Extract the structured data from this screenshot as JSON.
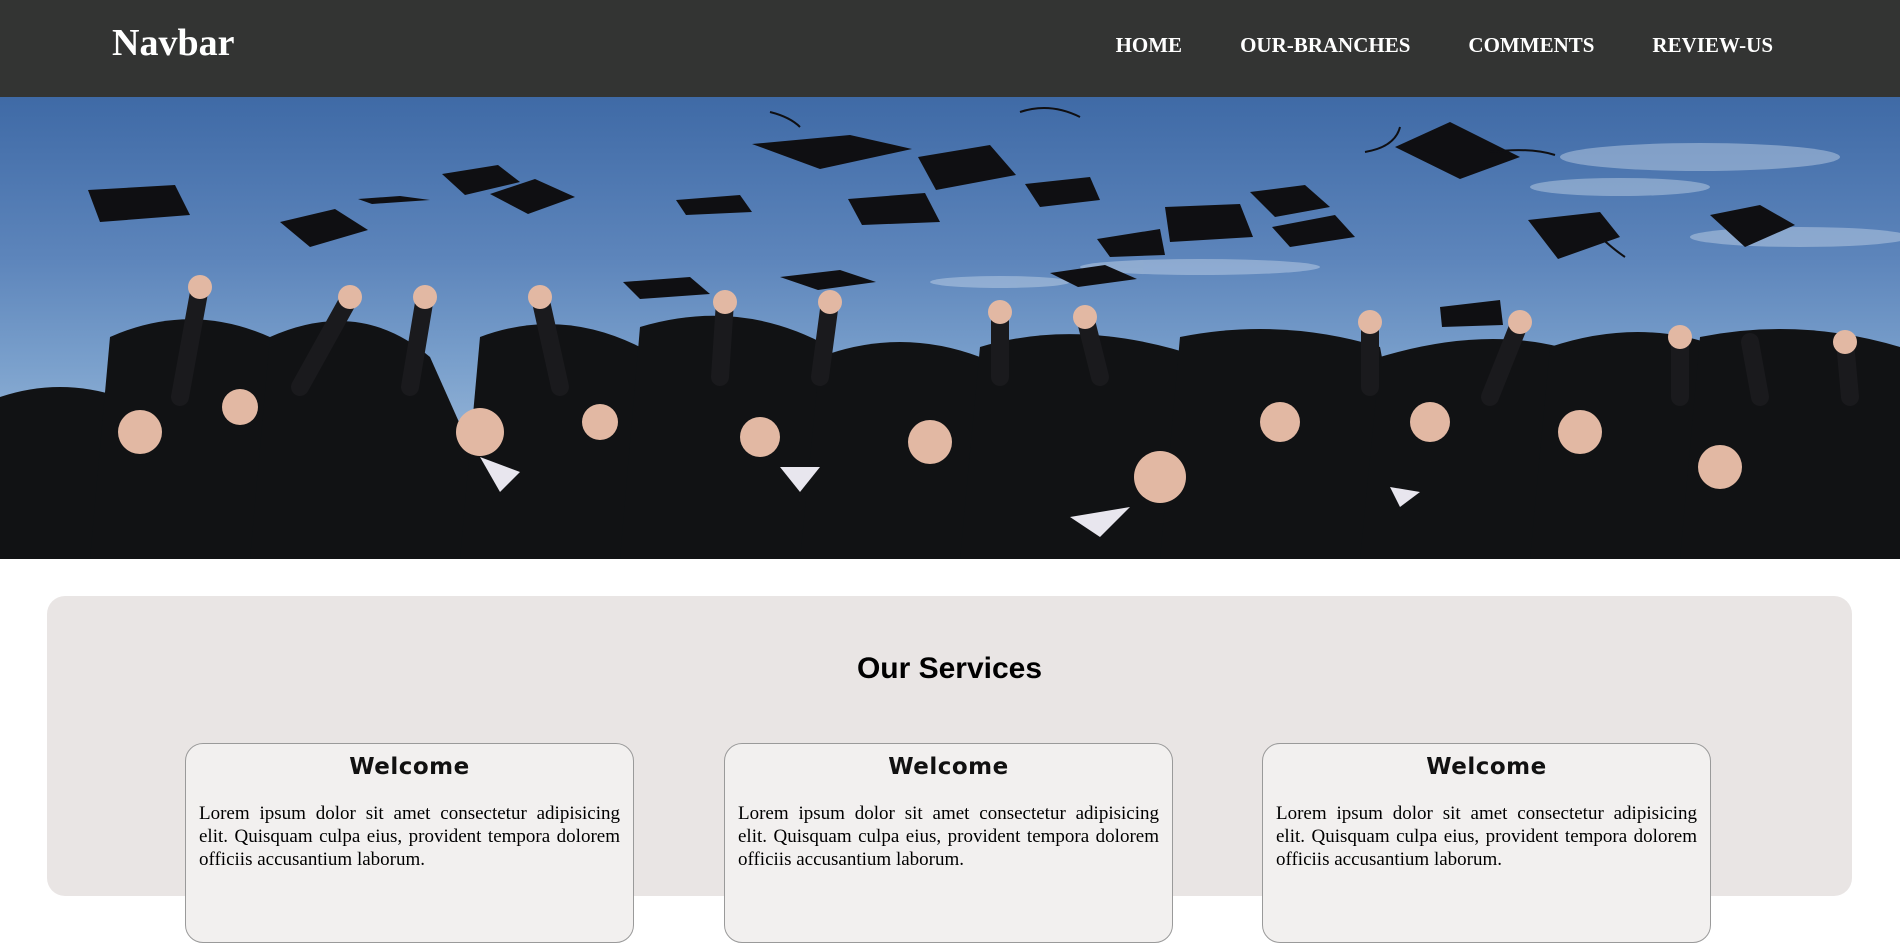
{
  "navbar": {
    "brand": "Navbar",
    "links": [
      {
        "label": "HOME"
      },
      {
        "label": "OUR-BRANCHES"
      },
      {
        "label": "COMMENTS"
      },
      {
        "label": "REVIEW-US"
      }
    ]
  },
  "hero": {
    "image_alt": "graduates-throwing-caps-photo"
  },
  "services": {
    "title": "Our Services",
    "cards": [
      {
        "title": "Welcome",
        "text": "Lorem ipsum dolor sit amet consectetur adipisicing elit. Quisquam culpa eius, provident tempora dolorem officiis accusantium laborum."
      },
      {
        "title": "Welcome",
        "text": "Lorem ipsum dolor sit amet consectetur adipisicing elit. Quisquam culpa eius, provident tempora dolorem officiis accusantium laborum."
      },
      {
        "title": "Welcome",
        "text": "Lorem ipsum dolor sit amet consectetur adipisicing elit. Quisquam culpa eius, provident tempora dolorem officiis accusantium laborum."
      }
    ]
  },
  "colors": {
    "navbar_bg": "#333433",
    "services_bg": "#e9e5e4",
    "card_bg": "#f2f0ef"
  }
}
